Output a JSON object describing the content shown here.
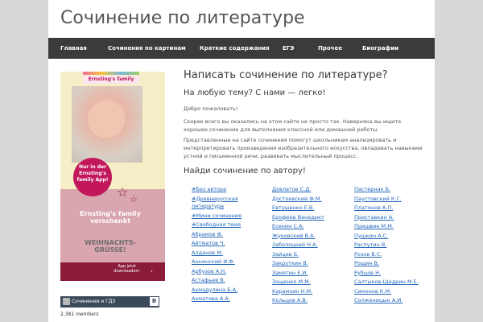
{
  "site": {
    "title": "Сочинение по литературе"
  },
  "nav": {
    "items": [
      "Главная",
      "Сочинения по картинам",
      "Краткие содержания",
      "ЕГЭ",
      "Прочее",
      "Биографии"
    ]
  },
  "banner": {
    "brand": "Ernsting's family",
    "circle_text": "Nur in der Ernsting's family App!",
    "pink_text": "Ernsting's family verschenkt",
    "grey_text": "WEIHNACHTS-GRÜSSE!",
    "app_text": "App jetzt downloaden!"
  },
  "widget": {
    "title": "Сочинения и ГДЗ",
    "vk": "В",
    "members": "2,381 members"
  },
  "main": {
    "heading": "Написать сочинение по литературе?",
    "subheading": "На любую тему? С нами — легко!",
    "welcome": "Добро пожаловать!",
    "para1": "Скорее всего вы оказались на этом сайте не просто так. Наверняка вы ищите хорошее сочинение для выполнения классной или домашней работы.",
    "para2": "Представленные на сайте сочинения помогут школьникам анализировать и интерпретировать произведения изобразительного искусства, овладевать навыками устной и письменной речи, развивать мыслительный процесс.",
    "authors_heading": "Найди сочинение по автору!"
  },
  "authors": {
    "col1": [
      "#Без автора",
      "#Древнерусская литература",
      "#Мини сочинения",
      "#Свободная тема",
      "Абрамов Ф.",
      "Айтматов Ч.",
      "Алданов М.",
      "Анненский И.Ф.",
      "Арбузов А.Н.",
      "Астафьев В.",
      "Ахмадулина Б.А.",
      "Ахматова А.А."
    ],
    "col2": [
      "Довлатов С.Д.",
      "Достоевский Ф.М.",
      "Евтушенко Е.В.",
      "Ерофеев Венедикт",
      "Есенин С.А.",
      "Жуковский В.А.",
      "Заболоцкий Н.А.",
      "Зайцев Б.",
      "Закруткин В.",
      "Замятин Е.И.",
      "Зощенко М.М.",
      "Карамзин Н.М.",
      "Кольцов А.В."
    ],
    "col3": [
      "Пастернак Б.",
      "Паустовский К.Г.",
      "Платонов А.П.",
      "Приставкин А.",
      "Пришвин М.М.",
      "Пушкин А.С.",
      "Распутин В.",
      "Розов В.С.",
      "Рощин В.",
      "Рубцов Н.",
      "Салтыков-Щедрин М.Е.",
      "Симонов К.М.",
      "Солженицын А.И."
    ]
  },
  "colors": {
    "nav_bg": "#3b3b3b",
    "link": "#2266bb",
    "page_bg": "#d8d8d8"
  }
}
